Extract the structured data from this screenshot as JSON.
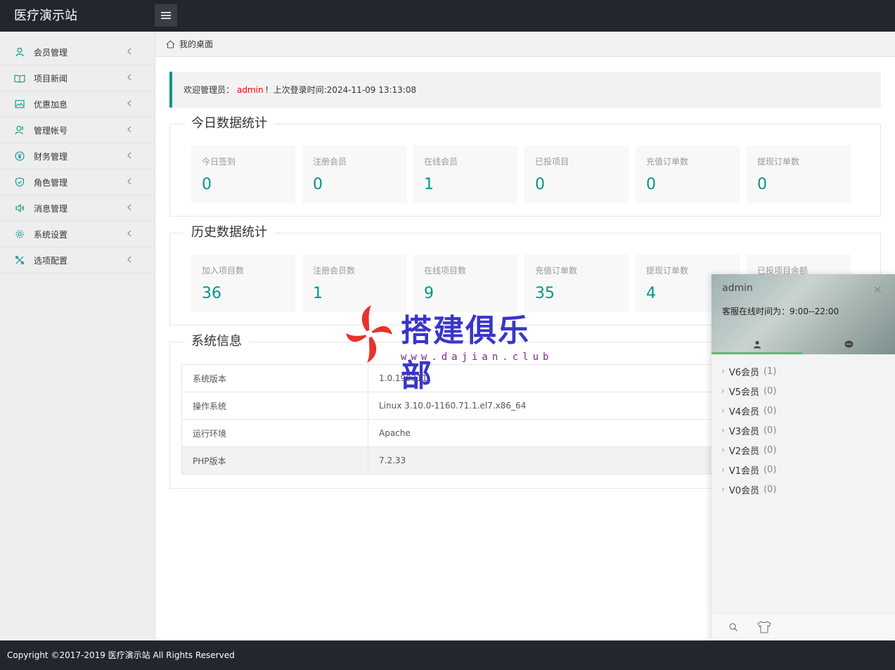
{
  "header": {
    "title": "医疗演示站"
  },
  "sidebar": {
    "items": [
      {
        "label": "会员管理",
        "icon": "user-icon"
      },
      {
        "label": "项目新闻",
        "icon": "book-icon"
      },
      {
        "label": "优惠加息",
        "icon": "image-icon"
      },
      {
        "label": "管理帐号",
        "icon": "users-icon"
      },
      {
        "label": "财务管理",
        "icon": "yen-icon"
      },
      {
        "label": "角色管理",
        "icon": "shield-icon"
      },
      {
        "label": "消息管理",
        "icon": "speaker-icon"
      },
      {
        "label": "系统设置",
        "icon": "gear-icon"
      },
      {
        "label": "选项配置",
        "icon": "tools-icon"
      }
    ]
  },
  "breadcrumb": {
    "label": "我的桌面"
  },
  "welcome": {
    "prefix": "欢迎管理员：",
    "user": "admin",
    "suffix": "！上次登录时间:2024-11-09 13:13:08"
  },
  "today": {
    "title": "今日数据统计",
    "cards": [
      {
        "label": "今日签到",
        "value": "0"
      },
      {
        "label": "注册会员",
        "value": "0"
      },
      {
        "label": "在线会员",
        "value": "1"
      },
      {
        "label": "已投项目",
        "value": "0"
      },
      {
        "label": "充值订单数",
        "value": "0"
      },
      {
        "label": "提现订单数",
        "value": "0"
      }
    ]
  },
  "history": {
    "title": "历史数据统计",
    "cards": [
      {
        "label": "加入项目数",
        "value": "36"
      },
      {
        "label": "注册会员数",
        "value": "1"
      },
      {
        "label": "在线项目数",
        "value": "9"
      },
      {
        "label": "充值订单数",
        "value": "35"
      },
      {
        "label": "提现订单数",
        "value": "4"
      },
      {
        "label": "已投项目余额",
        "value": ""
      }
    ]
  },
  "sysinfo": {
    "title": "系统信息",
    "rows": [
      {
        "key": "系统版本",
        "value": "1.0.190311"
      },
      {
        "key": "操作系统",
        "value": "Linux 3.10.0-1160.71.1.el7.x86_64"
      },
      {
        "key": "运行环境",
        "value": "Apache"
      },
      {
        "key": "PHP版本",
        "value": "7.2.33"
      }
    ]
  },
  "watermark": {
    "text": "搭建俱乐部",
    "url": "www.dajian.club"
  },
  "chat": {
    "name": "admin",
    "close": "×",
    "hours": "客服在线时间为：9:00--22:00",
    "groups": [
      {
        "label": "V6会员",
        "count": "(1)"
      },
      {
        "label": "V5会员",
        "count": "(0)"
      },
      {
        "label": "V4会员",
        "count": "(0)"
      },
      {
        "label": "V3会员",
        "count": "(0)"
      },
      {
        "label": "V2会员",
        "count": "(0)"
      },
      {
        "label": "V1会员",
        "count": "(0)"
      },
      {
        "label": "V0会员",
        "count": "(0)"
      }
    ]
  },
  "footer": {
    "text": "Copyright ©2017-2019 医疗演示站 All Rights Reserved"
  },
  "colors": {
    "accent": "#009688",
    "header": "#23262e",
    "admin": "#ff0000",
    "chat_tab": "#5fb878"
  }
}
